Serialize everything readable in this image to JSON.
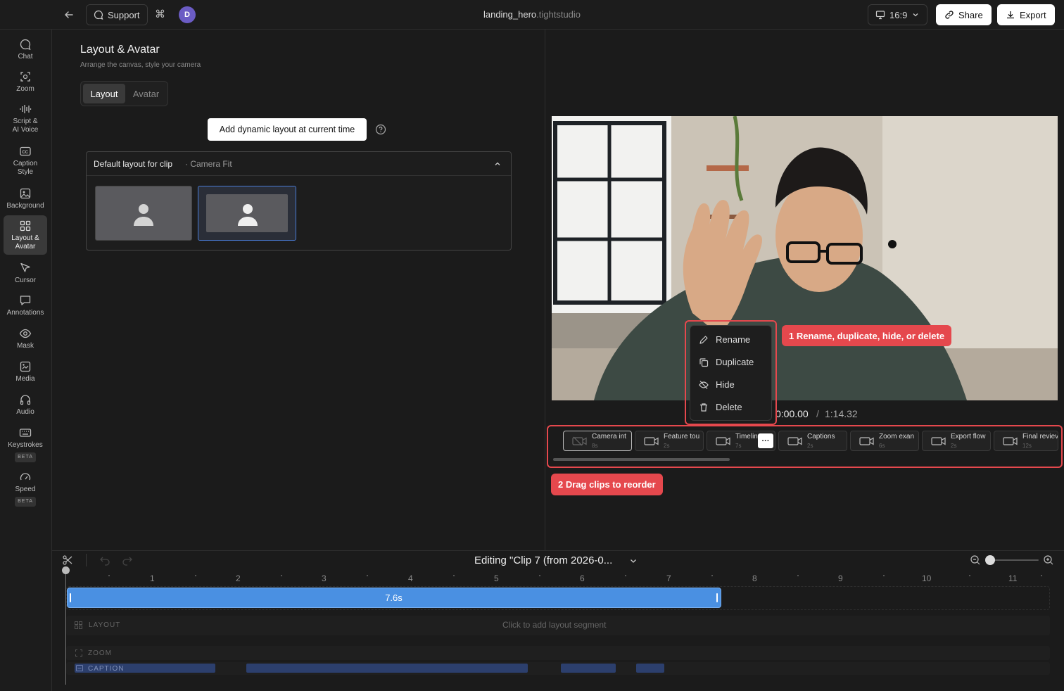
{
  "topbar": {
    "support": "Support",
    "avatar_initial": "D",
    "filename_main": "landing_hero",
    "filename_ext": ".tightstudio",
    "aspect": "16:9",
    "share": "Share",
    "export": "Export"
  },
  "sidebar": {
    "items": [
      {
        "label": "Chat"
      },
      {
        "label": "Zoom"
      },
      {
        "label": "Script &\nAI Voice"
      },
      {
        "label": "Caption\nStyle"
      },
      {
        "label": "Background"
      },
      {
        "label": "Layout &\nAvatar"
      },
      {
        "label": "Cursor"
      },
      {
        "label": "Annotations"
      },
      {
        "label": "Mask"
      },
      {
        "label": "Media"
      },
      {
        "label": "Audio"
      },
      {
        "label": "Keystrokes",
        "badge": "BETA"
      },
      {
        "label": "Speed",
        "badge": "BETA"
      }
    ]
  },
  "panel": {
    "title": "Layout & Avatar",
    "subtitle": "Arrange the canvas, style your camera",
    "tab_layout": "Layout",
    "tab_avatar": "Avatar",
    "add_dynamic": "Add dynamic layout at current time",
    "default_layout_label": "Default layout for clip",
    "default_layout_value": "· Camera Fit"
  },
  "player": {
    "current_time": "0:00.00",
    "separator": "/",
    "total_time": "1:14.32"
  },
  "clips": [
    {
      "name": "Camera int",
      "duration": "8s"
    },
    {
      "name": "Feature tou",
      "duration": "2s"
    },
    {
      "name": "Timelin",
      "duration": "7s"
    },
    {
      "name": "Captions",
      "duration": "2s"
    },
    {
      "name": "Zoom exan",
      "duration": "6s"
    },
    {
      "name": "Export flow",
      "duration": "2s"
    },
    {
      "name": "Final reviev",
      "duration": "12s"
    }
  ],
  "context_menu": {
    "rename": "Rename",
    "duplicate": "Duplicate",
    "hide": "Hide",
    "delete": "Delete"
  },
  "callouts": {
    "one": "1 Rename, duplicate, hide, or delete",
    "two": "2 Drag clips to reorder"
  },
  "timeline": {
    "editing_title": "Editing \"Clip 7 (from 2026-0...",
    "ticks": [
      "1",
      "2",
      "3",
      "4",
      "5",
      "6",
      "7",
      "8",
      "9",
      "10",
      "11"
    ],
    "clip_duration": "7.6s",
    "layout_track": "LAYOUT",
    "layout_hint": "Click to add layout segment",
    "zoom_track": "ZOOM",
    "caption_track": "CAPTION"
  },
  "colors": {
    "accent_blue": "#4a90e2",
    "callout_red": "#e5484d",
    "caption_segment": "#2c3f6d",
    "avatar_purple": "#6b5cc4"
  }
}
